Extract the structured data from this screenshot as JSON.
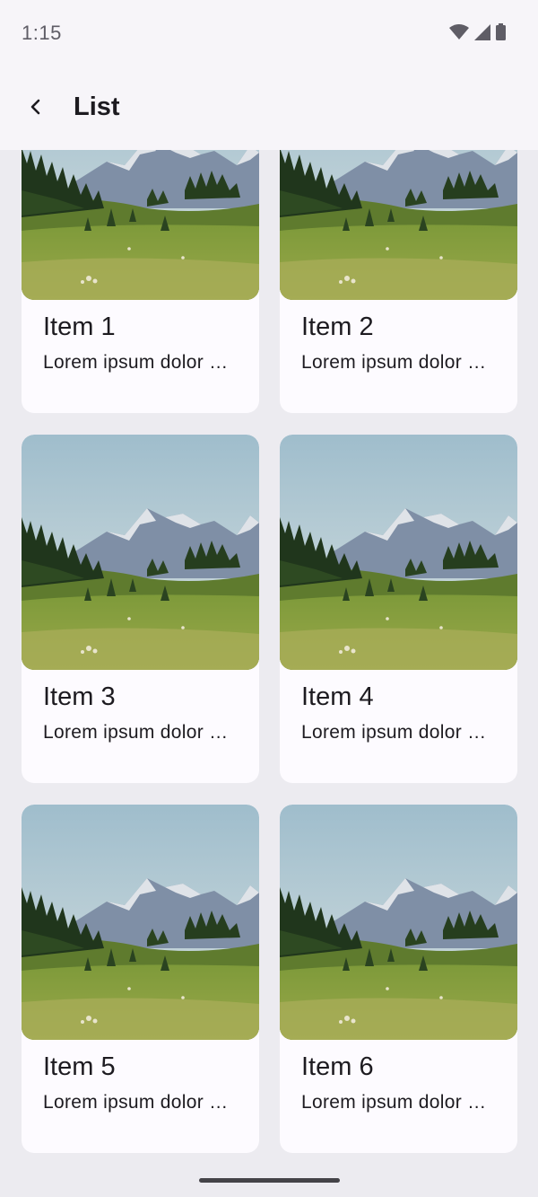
{
  "status_bar": {
    "time": "1:15",
    "icons": [
      "wifi-icon",
      "cellular-signal-icon",
      "battery-icon"
    ]
  },
  "app_bar": {
    "back_icon": "chevron-left-icon",
    "title": "List"
  },
  "items": [
    {
      "title": "Item 1",
      "subtitle": "Lorem ipsum dolor sit amet",
      "image": "mountain-meadow-image"
    },
    {
      "title": "Item 2",
      "subtitle": "Lorem ipsum dolor sit amet",
      "image": "mountain-meadow-image"
    },
    {
      "title": "Item 3",
      "subtitle": "Lorem ipsum dolor sit amet",
      "image": "mountain-meadow-image"
    },
    {
      "title": "Item 4",
      "subtitle": "Lorem ipsum dolor sit amet",
      "image": "mountain-meadow-image"
    },
    {
      "title": "Item 5",
      "subtitle": "Lorem ipsum dolor sit amet",
      "image": "mountain-meadow-image"
    },
    {
      "title": "Item 6",
      "subtitle": "Lorem ipsum dolor sit amet",
      "image": "mountain-meadow-image"
    }
  ],
  "colors": {
    "background": "#ecebf0",
    "surface": "#f7f5f9",
    "card": "#fdfbff",
    "text": "#1d1b20"
  }
}
